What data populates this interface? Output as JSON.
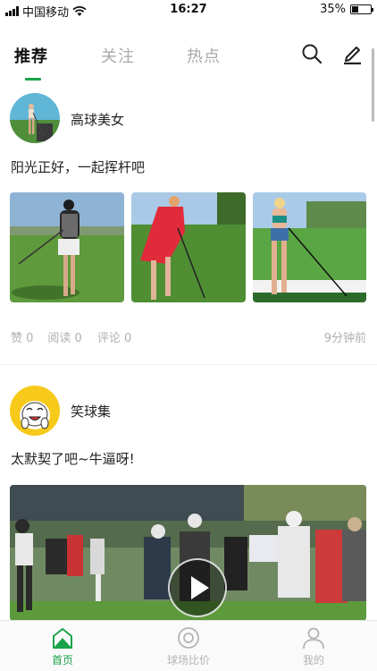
{
  "status_bar": {
    "carrier": "中国移动",
    "time": "16:27",
    "battery": "35%",
    "battery_level": 0.35
  },
  "top_nav": {
    "tabs": [
      {
        "label": "推荐",
        "active": true
      },
      {
        "label": "关注",
        "active": false
      },
      {
        "label": "热点",
        "active": false
      }
    ],
    "accent_color": "#1aa34a",
    "icons": [
      "search-icon",
      "edit-icon"
    ]
  },
  "posts": [
    {
      "author": "高球美女",
      "text": "阳光正好，一起挥杆吧",
      "stats": {
        "likes": "赞 0",
        "reads": "阅读 0",
        "comments": "评论 0"
      },
      "time_ago": "9分钟前",
      "media": "three-image-grid"
    },
    {
      "author": "笑球集",
      "text": "太默契了吧~牛逼呀!",
      "media": "video"
    }
  ],
  "bottom_nav": {
    "items": [
      {
        "label": "首页",
        "icon": "home-icon",
        "active": true
      },
      {
        "label": "球场比价",
        "icon": "course-icon",
        "active": false
      },
      {
        "label": "我的",
        "icon": "profile-icon",
        "active": false
      }
    ]
  }
}
